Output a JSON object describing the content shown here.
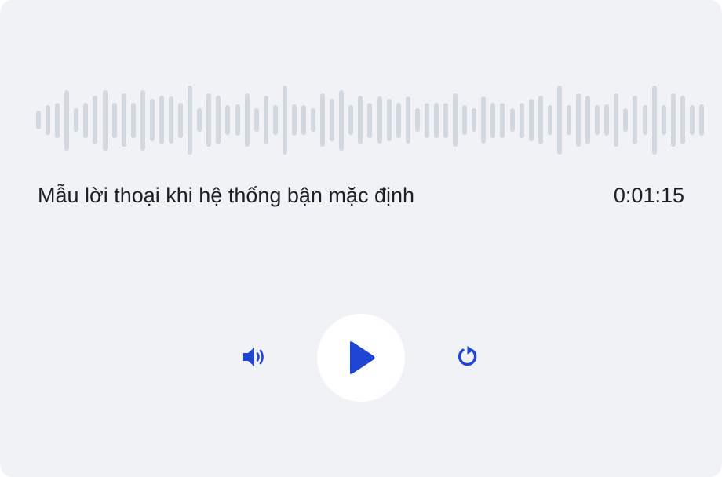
{
  "player": {
    "title": "Mẫu lời thoại khi hệ thống bận mặc định",
    "duration": "0:01:15"
  },
  "waveform": {
    "levels": [
      0.24,
      0.38,
      0.45,
      0.77,
      0.3,
      0.45,
      0.62,
      0.77,
      0.45,
      0.68,
      0.45,
      0.77,
      0.54,
      0.62,
      0.6,
      0.45,
      0.88,
      0.3,
      0.68,
      0.62,
      0.38,
      0.4,
      0.68,
      0.3,
      0.62,
      0.38,
      0.88,
      0.4,
      0.38,
      0.3,
      0.68,
      0.54,
      0.77,
      0.38,
      0.62,
      0.45,
      0.6,
      0.54,
      0.45,
      0.6,
      0.3,
      0.45,
      0.45,
      0.45,
      0.68,
      0.38,
      0.3,
      0.6,
      0.45,
      0.45,
      0.3,
      0.45,
      0.54,
      0.62,
      0.38,
      0.88,
      0.38,
      0.68,
      0.62,
      0.38,
      0.4,
      0.68,
      0.3,
      0.62,
      0.38,
      0.88,
      0.38,
      0.68,
      0.62,
      0.38,
      0.4
    ],
    "color": "#d2d8e0"
  },
  "controls": {
    "accent_color": "#1f45d4",
    "icons": [
      "volume-icon",
      "play-icon",
      "replay-icon"
    ]
  }
}
